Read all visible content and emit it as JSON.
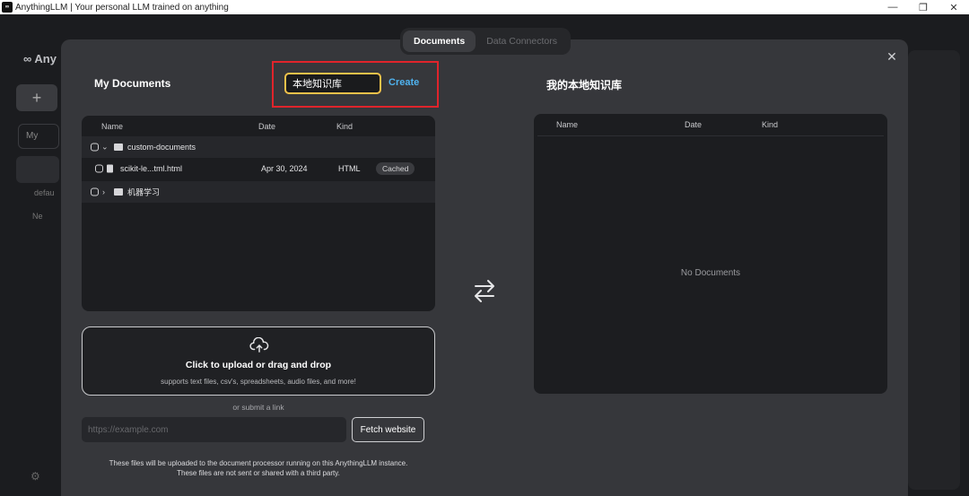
{
  "window": {
    "title": "AnythingLLM | Your personal LLM trained on anything",
    "icon_text": "∞"
  },
  "background": {
    "logo": "∞ Any",
    "search": "My",
    "default_label": "defau",
    "new_label": "Ne"
  },
  "tabs": [
    {
      "label": "Documents",
      "active": true
    },
    {
      "label": "Data Connectors",
      "active": false
    }
  ],
  "my_documents": {
    "heading": "My Documents",
    "columns": {
      "name": "Name",
      "date": "Date",
      "kind": "Kind"
    },
    "rows": [
      {
        "type": "folder",
        "expanded": true,
        "name": "custom-documents"
      },
      {
        "type": "file",
        "name": "scikit-le...tml.html",
        "date": "Apr 30, 2024",
        "kind": "HTML",
        "badge": "Cached"
      },
      {
        "type": "folder",
        "expanded": false,
        "name": "机器学习"
      }
    ]
  },
  "workspace_form": {
    "value": "本地知识库",
    "create_label": "Create"
  },
  "workspace": {
    "heading": "我的本地知识库",
    "columns": {
      "name": "Name",
      "date": "Date",
      "kind": "Kind"
    },
    "empty_text": "No Documents"
  },
  "upload": {
    "title": "Click to upload or drag and drop",
    "subtitle": "supports text files, csv's, spreadsheets, audio files, and more!",
    "or_link": "or submit a link",
    "url_placeholder": "https://example.com",
    "fetch_label": "Fetch website",
    "note_line1": "These files will be uploaded to the document processor running on this AnythingLLM instance.",
    "note_line2": "These files are not sent or shared with a third party."
  },
  "colors": {
    "accent_link": "#4fb3f0",
    "input_focus": "#f3c24a",
    "highlight": "#e0242b"
  }
}
